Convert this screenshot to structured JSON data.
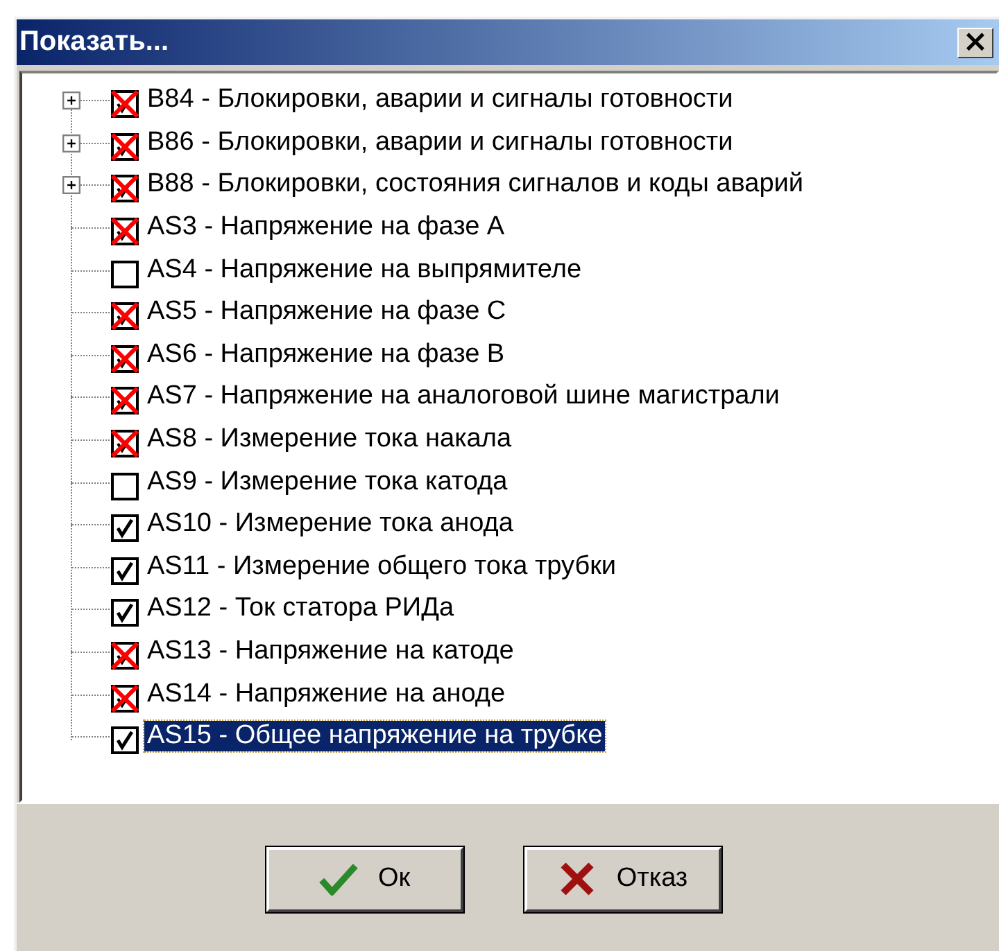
{
  "window": {
    "title": "Показать...",
    "close": "×"
  },
  "items": [
    {
      "kind": "group",
      "checked": true,
      "blocked": true,
      "selected": false,
      "label": "B84 - Блокировки, аварии и сигналы готовности"
    },
    {
      "kind": "group",
      "checked": true,
      "blocked": true,
      "selected": false,
      "label": "B86 - Блокировки, аварии и сигналы готовности"
    },
    {
      "kind": "group",
      "checked": true,
      "blocked": true,
      "selected": false,
      "label": "B88 - Блокировки, состояния сигналов и коды аварий"
    },
    {
      "kind": "leaf",
      "checked": true,
      "blocked": true,
      "selected": false,
      "label": "AS3 - Напряжение на фазе А"
    },
    {
      "kind": "leaf",
      "checked": false,
      "blocked": false,
      "selected": false,
      "label": "AS4 - Напряжение на выпрямителе"
    },
    {
      "kind": "leaf",
      "checked": true,
      "blocked": true,
      "selected": false,
      "label": "AS5 - Напряжение на фазе С"
    },
    {
      "kind": "leaf",
      "checked": true,
      "blocked": true,
      "selected": false,
      "label": "AS6 - Напряжение на фазе В"
    },
    {
      "kind": "leaf",
      "checked": true,
      "blocked": true,
      "selected": false,
      "label": "AS7 - Напряжение на аналоговой шине магистрали"
    },
    {
      "kind": "leaf",
      "checked": true,
      "blocked": true,
      "selected": false,
      "label": "AS8 - Измерение тока накала"
    },
    {
      "kind": "leaf",
      "checked": false,
      "blocked": false,
      "selected": false,
      "label": "AS9 - Измерение тока катода"
    },
    {
      "kind": "leaf",
      "checked": true,
      "blocked": false,
      "selected": false,
      "label": "AS10 - Измерение тока анода"
    },
    {
      "kind": "leaf",
      "checked": true,
      "blocked": false,
      "selected": false,
      "label": "AS11 - Измерение общего тока трубки"
    },
    {
      "kind": "leaf",
      "checked": true,
      "blocked": false,
      "selected": false,
      "label": "AS12 - Ток статора РИДа"
    },
    {
      "kind": "leaf",
      "checked": true,
      "blocked": true,
      "selected": false,
      "label": "AS13 - Напряжение на катоде"
    },
    {
      "kind": "leaf",
      "checked": true,
      "blocked": true,
      "selected": false,
      "label": "AS14 - Напряжение на аноде"
    },
    {
      "kind": "leaf",
      "checked": true,
      "blocked": false,
      "selected": true,
      "label": "AS15 - Общее напряжение на трубке"
    }
  ],
  "buttons": [
    {
      "kind": "ok",
      "label": "Ок"
    },
    {
      "kind": "cancel",
      "label": "Отказ"
    }
  ]
}
